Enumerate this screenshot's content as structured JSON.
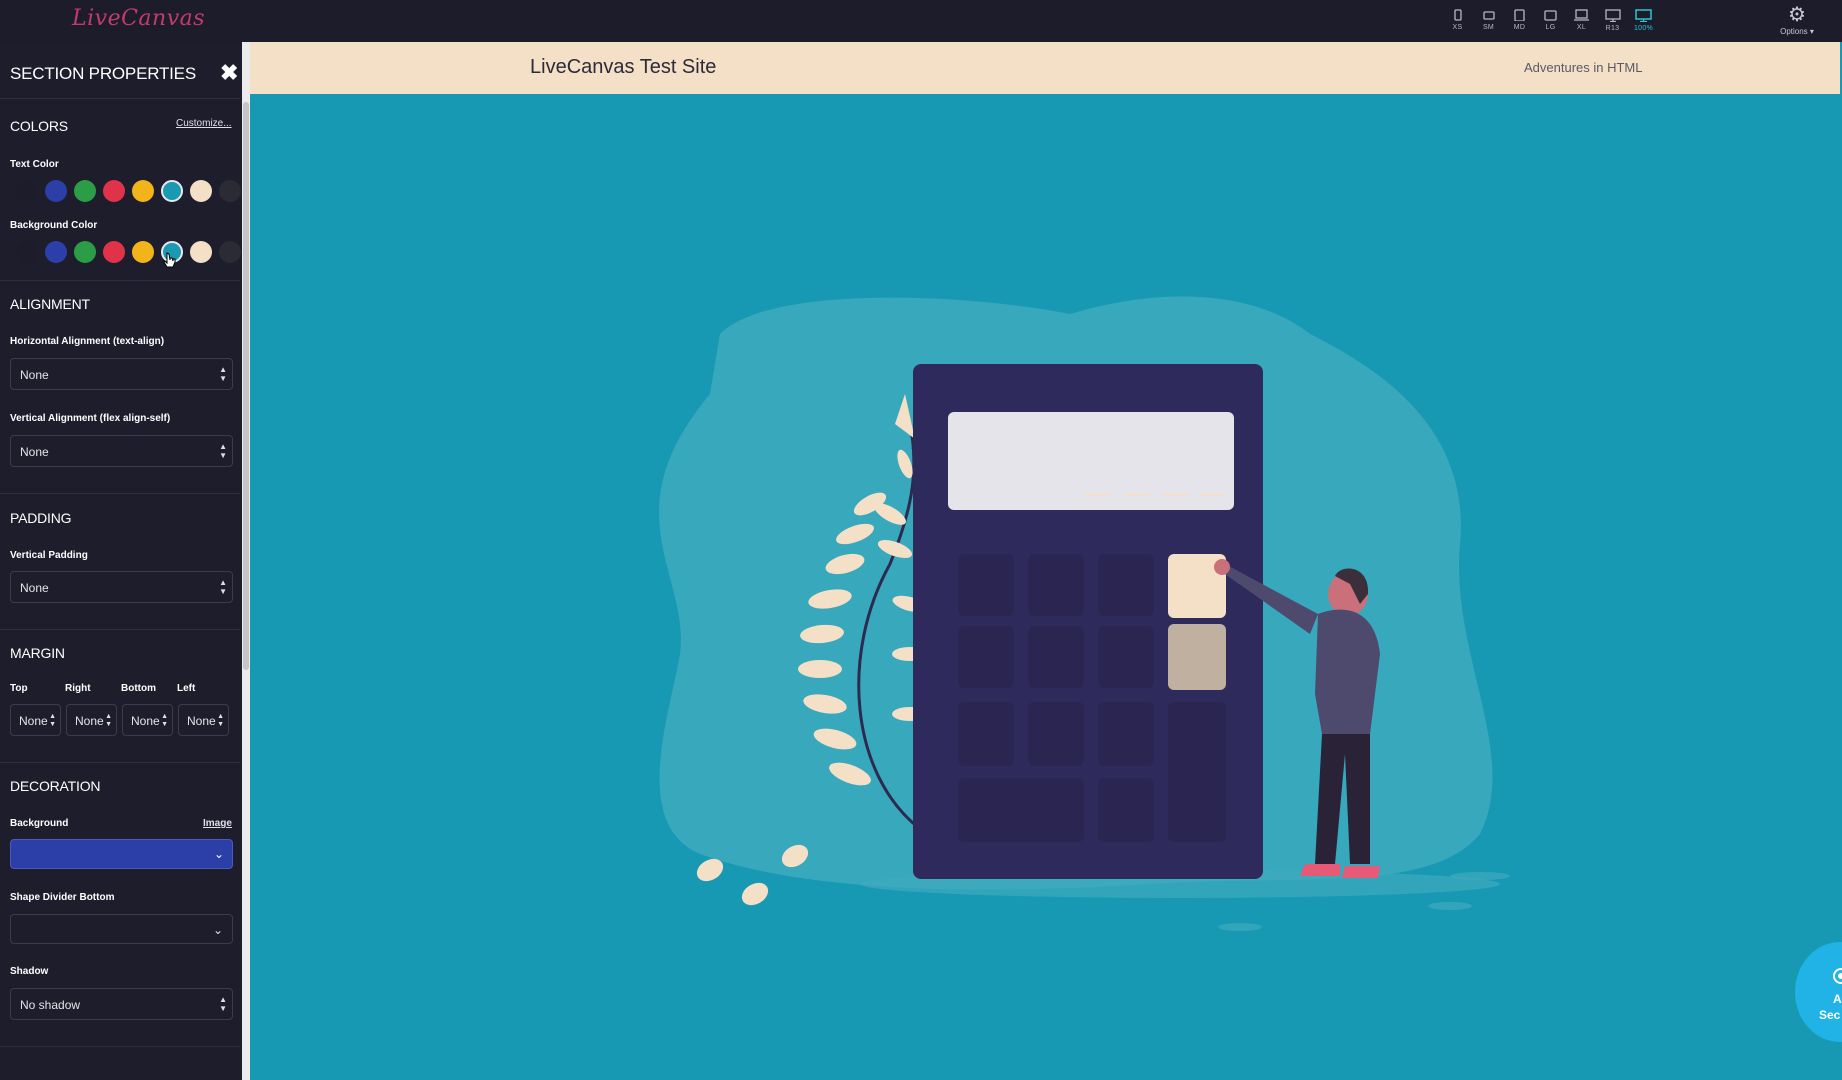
{
  "app": {
    "logo_text": "LiveCanvas",
    "options_label": "Options ▾",
    "devices": [
      {
        "label": "XS",
        "active": false
      },
      {
        "label": "SM",
        "active": false
      },
      {
        "label": "MD",
        "active": false
      },
      {
        "label": "LG",
        "active": false
      },
      {
        "label": "XL",
        "active": false
      },
      {
        "label": "R13",
        "active": false
      },
      {
        "label": "100%",
        "active": true
      }
    ]
  },
  "sidebar": {
    "title": "SECTION PROPERTIES",
    "colors": {
      "heading": "COLORS",
      "customize_link": "Customize...",
      "text_color_label": "Text Color",
      "background_color_label": "Background Color",
      "palette": [
        "#1c1c2b",
        "#2c3ea8",
        "#2a9d46",
        "#e0334a",
        "#f3b41b",
        "#1a9ab2",
        "#f4dfc7",
        "#2b2b35"
      ],
      "selected_background": "#1a9ab2"
    },
    "alignment": {
      "heading": "ALIGNMENT",
      "horizontal_label": "Horizontal Alignment (text-align)",
      "horizontal_value": "None",
      "vertical_label": "Vertical Alignment (flex align-self)",
      "vertical_value": "None"
    },
    "padding": {
      "heading": "PADDING",
      "vertical_label": "Vertical Padding",
      "vertical_value": "None"
    },
    "margin": {
      "heading": "MARGIN",
      "top_label": "Top",
      "right_label": "Right",
      "bottom_label": "Bottom",
      "left_label": "Left",
      "top_value": "None",
      "right_value": "None",
      "bottom_value": "None",
      "left_value": "None"
    },
    "decoration": {
      "heading": "DECORATION",
      "background_label": "Background",
      "image_link": "Image",
      "background_value_color": "#2c3ea8",
      "shape_divider_label": "Shape Divider Bottom",
      "shape_divider_value": "",
      "shadow_label": "Shadow",
      "shadow_value": "No shadow"
    }
  },
  "site": {
    "title": "LiveCanvas Test Site",
    "tagline": "Adventures in HTML"
  },
  "fab": {
    "line1": "A",
    "line2": "Sec"
  }
}
